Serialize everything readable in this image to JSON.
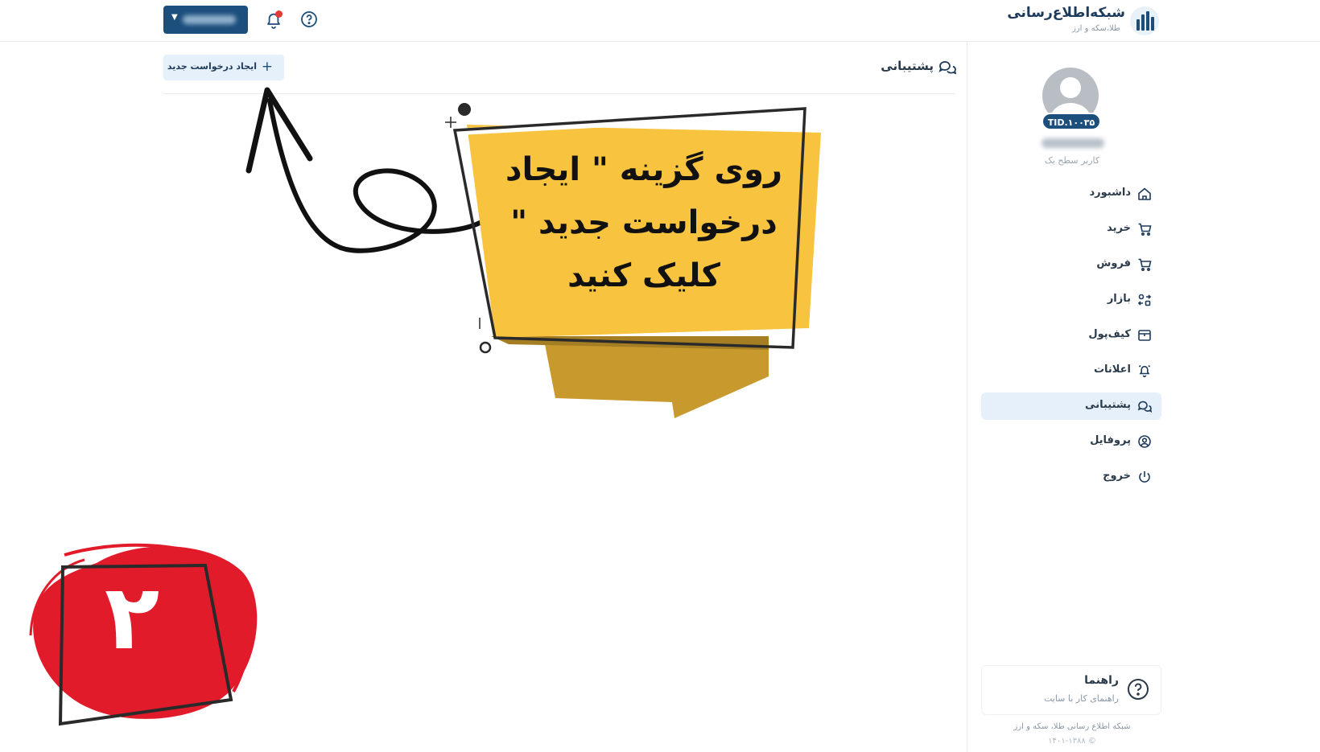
{
  "brand": {
    "name": "شبکه‌اطلاع‌رسانی",
    "subtitle": "طلا،سکه و ارز"
  },
  "header": {
    "user_button_icon": "chevron-down-icon",
    "notification_icon": "bell-icon",
    "help_icon": "help-circle-icon"
  },
  "profile": {
    "tid": "TID.۱۰۰۳۵",
    "level": "کاربر سطح یک"
  },
  "sidebar": {
    "items": [
      {
        "label": "داشبورد",
        "icon": "home-icon"
      },
      {
        "label": "خرید",
        "icon": "cart-icon"
      },
      {
        "label": "فروش",
        "icon": "cart-icon"
      },
      {
        "label": "بازار",
        "icon": "exchange-icon"
      },
      {
        "label": "کیف‌پول",
        "icon": "wallet-icon"
      },
      {
        "label": "اعلانات",
        "icon": "bell-icon"
      },
      {
        "label": "پشتیبانی",
        "icon": "chat-icon",
        "active": true
      },
      {
        "label": "پروفایل",
        "icon": "user-circle-icon"
      },
      {
        "label": "خروج",
        "icon": "power-icon"
      }
    ],
    "guide": {
      "title": "راهنما",
      "subtitle": "راهنمای کار با سایت"
    },
    "footer": {
      "line1": "شبکه اطلاع رسانی طلا، سکه و ارز",
      "line2": "© ۱۴۰۱-۱۳۸۸"
    }
  },
  "main": {
    "title": "پشتیبانی",
    "new_request_label": "ایجاد درخواست جدید"
  },
  "annotation": {
    "banner_lines": [
      "روی گزینه \" ایجاد",
      "درخواست جدید \"",
      "کلیک کنید"
    ],
    "step_number": "۲",
    "colors": {
      "banner": "#f8c43f",
      "banner_shadow": "#c89a2e",
      "badge": "#e21b2a",
      "accent": "#1d4f7c",
      "active_bg": "#e6f0fa"
    }
  }
}
